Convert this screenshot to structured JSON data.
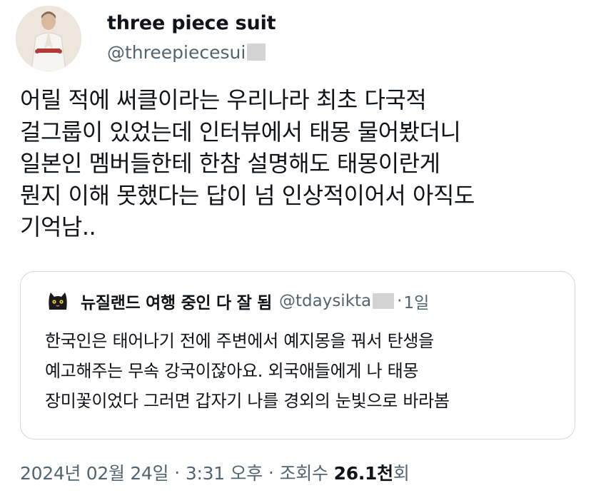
{
  "author": {
    "display_name": "three piece suit",
    "handle": "@threepiecesui"
  },
  "tweet": {
    "lines": [
      "어릴 적에 써클이라는 우리나라 최초 다국적",
      "걸그룹이 있었는데 인터뷰에서 태몽 물어봤더니",
      "일본인 멤버들한테 한참 설명해도 태몽이란게",
      "뭔지 이해 못했다는 답이 넘 인상적이어서 아직도",
      "기억남.."
    ]
  },
  "quote": {
    "display_name": "뉴질랜드 여행 중인 다 잘 됨",
    "handle": "@tdaysikta",
    "separator": "·",
    "time": "1일",
    "lines": [
      "한국인은 태어나기 전에 주변에서 예지몽을 꿔서 탄생을",
      "예고해주는 무속 강국이잖아요. 외국애들에게 나 태몽",
      "장미꽃이었다 그러면 갑자기 나를 경외의 눈빛으로 바라봄"
    ]
  },
  "meta": {
    "date": "2024년 02월 24일",
    "sep1": "·",
    "time": "3:31 오후",
    "sep2": "·",
    "views_label": "조회수",
    "views_count": "26.1",
    "views_unit": "천",
    "views_suffix": "회"
  },
  "colors": {
    "text": "#0f1419",
    "secondary": "#536471",
    "border": "#cfd9de",
    "redaction": "#d4d4d4"
  }
}
